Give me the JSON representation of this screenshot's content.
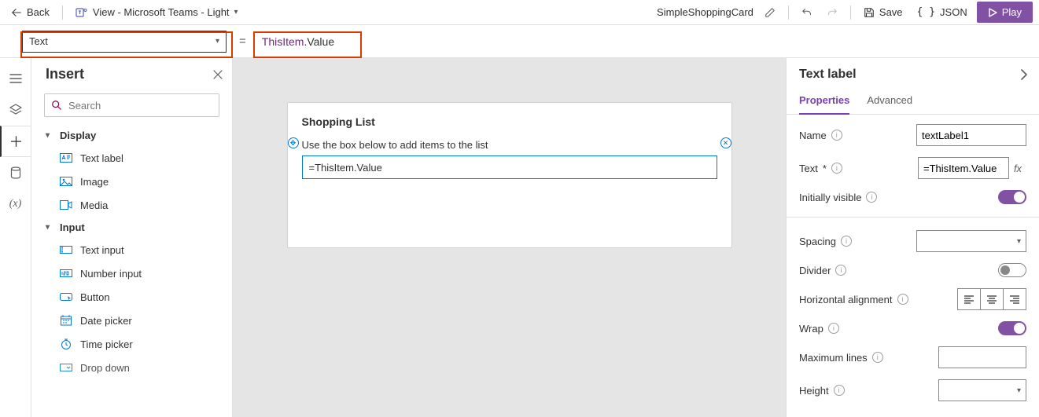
{
  "topbar": {
    "back": "Back",
    "theme_label": "View - Microsoft Teams - Light",
    "app_name": "SimpleShoppingCard",
    "save": "Save",
    "json": "JSON",
    "play": "Play"
  },
  "formula": {
    "property": "Text",
    "expr_obj": "ThisItem",
    "expr_prop": ".Value"
  },
  "insert": {
    "title": "Insert",
    "search_placeholder": "Search",
    "cat_display": "Display",
    "cat_input": "Input",
    "items_display": [
      "Text label",
      "Image",
      "Media"
    ],
    "items_input": [
      "Text input",
      "Number input",
      "Button",
      "Date picker",
      "Time picker",
      "Drop down"
    ]
  },
  "canvas": {
    "card_title": "Shopping List",
    "card_subtitle": "Use the box below to add items to the list",
    "bound_value": "=ThisItem.Value"
  },
  "props": {
    "header": "Text label",
    "tab_properties": "Properties",
    "tab_advanced": "Advanced",
    "name_label": "Name",
    "name_value": "textLabel1",
    "text_label": "Text",
    "text_value": "=ThisItem.Value",
    "visible_label": "Initially visible",
    "spacing_label": "Spacing",
    "divider_label": "Divider",
    "halign_label": "Horizontal alignment",
    "wrap_label": "Wrap",
    "maxlines_label": "Maximum lines",
    "height_label": "Height"
  }
}
